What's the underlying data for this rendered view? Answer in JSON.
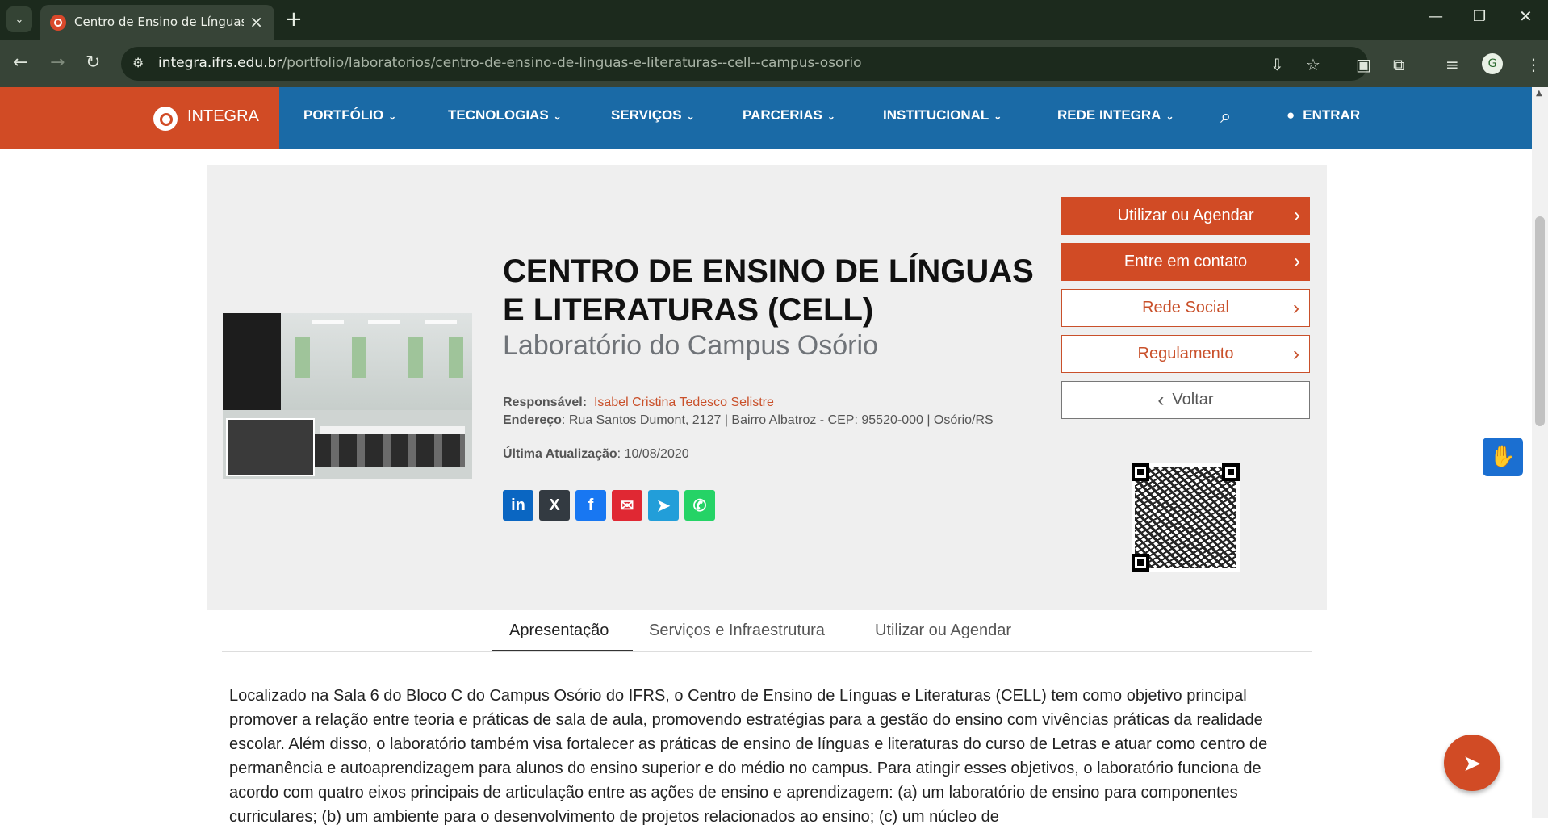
{
  "browser": {
    "tab_title": "Centro de Ensino de Línguas e",
    "url_domain": "integra.ifrs.edu.br",
    "url_path": "/portfolio/laboratorios/centro-de-ensino-de-linguas-e-literaturas--cell--campus-osorio",
    "profile_initial": "G"
  },
  "site": {
    "brand": "INTEGRA",
    "menu": [
      {
        "label": "PORTFÓLIO"
      },
      {
        "label": "TECNOLOGIAS"
      },
      {
        "label": "SERVIÇOS"
      },
      {
        "label": "PARCERIAS"
      },
      {
        "label": "INSTITUCIONAL"
      },
      {
        "label": "REDE INTEGRA"
      }
    ],
    "login_label": "ENTRAR"
  },
  "lab": {
    "title": "CENTRO DE ENSINO DE LÍNGUAS E LITERATURAS (CELL)",
    "subtitle": "Laboratório do Campus Osório",
    "responsavel_label": "Responsável:",
    "responsavel": "Isabel Cristina Tedesco Selistre",
    "endereco_label": "Endereço",
    "endereco": ": Rua Santos Dumont, 2127 | Bairro Albatroz - CEP: 95520-000 | Osório/RS",
    "atualizacao_label": "Última Atualização",
    "atualizacao": ": 10/08/2020"
  },
  "share": [
    {
      "name": "linkedin",
      "glyph": "in",
      "color": "#0a66c2"
    },
    {
      "name": "x",
      "glyph": "X",
      "color": "#333a41"
    },
    {
      "name": "facebook",
      "glyph": "f",
      "color": "#1877f2"
    },
    {
      "name": "email",
      "glyph": "✉",
      "color": "#e02833"
    },
    {
      "name": "telegram",
      "glyph": "➤",
      "color": "#229ed9"
    },
    {
      "name": "whatsapp",
      "glyph": "✆",
      "color": "#25d366"
    }
  ],
  "actions": {
    "use_schedule": "Utilizar ou Agendar",
    "contact": "Entre em contato",
    "social": "Rede Social",
    "regulation": "Regulamento",
    "back": "Voltar"
  },
  "tabs": [
    {
      "label": "Apresentação",
      "active": true
    },
    {
      "label": "Serviços e Infraestrutura",
      "active": false
    },
    {
      "label": "Utilizar ou Agendar",
      "active": false
    }
  ],
  "description": "Localizado na Sala 6 do Bloco C do Campus Osório do IFRS, o Centro de Ensino de Línguas e Literaturas (CELL) tem como objetivo principal promover a relação entre teoria e práticas de sala de aula, promovendo estratégias para a gestão do ensino com vivências práticas da realidade escolar. Além disso, o laboratório também visa fortalecer as práticas de ensino de línguas e literaturas do curso de Letras e atuar como centro de permanência e autoaprendizagem para alunos do ensino superior e do médio no campus. Para atingir esses objetivos, o laboratório funciona de acordo com quatro eixos principais de articulação entre as ações de ensino e aprendizagem: (a) um laboratório de ensino para componentes curriculares; (b) um ambiente para o desenvolvimento de projetos relacionados ao ensino; (c) um núcleo de"
}
